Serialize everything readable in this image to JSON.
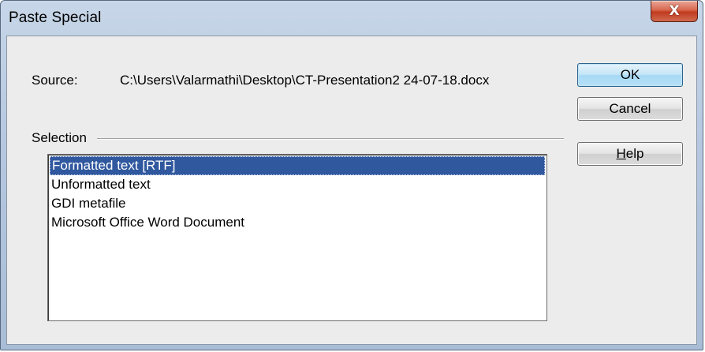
{
  "window": {
    "title": "Paste Special",
    "close_glyph": "X"
  },
  "source": {
    "label": "Source:",
    "path": "C:\\Users\\Valarmathi\\Desktop\\CT-Presentation2 24-07-18.docx"
  },
  "selection": {
    "label": "Selection",
    "items": [
      {
        "label": "Formatted text [RTF]",
        "selected": true
      },
      {
        "label": "Unformatted text",
        "selected": false
      },
      {
        "label": "GDI metafile",
        "selected": false
      },
      {
        "label": "Microsoft Office Word Document",
        "selected": false
      }
    ]
  },
  "buttons": {
    "ok": "OK",
    "cancel": "Cancel",
    "help_mnemonic": "H",
    "help_rest": "elp"
  },
  "colors": {
    "selection_bg": "#30589f",
    "close_button": "#c13b1f",
    "default_button_border": "#2c628b"
  }
}
